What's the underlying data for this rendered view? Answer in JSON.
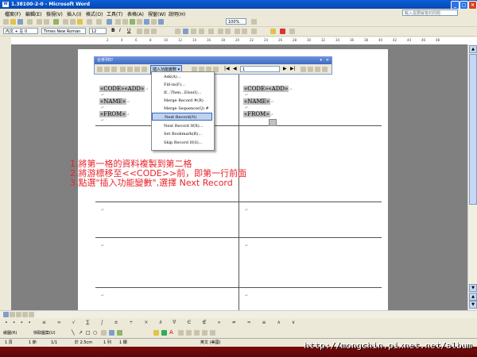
{
  "window": {
    "title": "1.38100-2-0 - Microsoft Word"
  },
  "menubar": {
    "items": [
      "檔案(F)",
      "編輯(E)",
      "檢視(V)",
      "插入(I)",
      "格式(O)",
      "工具(T)",
      "表格(A)",
      "視窗(W)",
      "說明(H)"
    ],
    "help_placeholder": "輸入需要解答的問題"
  },
  "toolbar": {
    "zoom": "100%",
    "style": "內文 + 左 0",
    "font": "Times New Roman",
    "size": "12"
  },
  "mailmerge_toolbar": {
    "title": "合併列印",
    "insert_word_field_label": "插入功能變數",
    "record_number": "1"
  },
  "dropdown": {
    "items": [
      "Ask(A)...",
      "Fill-in(F)...",
      "If...Then...Else(I)...",
      "Merge Record #(R)",
      "Merge Sequence(Q) #",
      "Next Record(N)",
      "Next Record If(X)...",
      "Set Bookmark(B)...",
      "Skip Record If(S)..."
    ],
    "selected_index": 5
  },
  "document": {
    "left_cell": {
      "line1": "«CODE»«ADD»",
      "line2": "«NAME»",
      "line3": "«FROM»"
    },
    "right_cell": {
      "line1": "«CODE»«ADD»",
      "line2": "«NAME»",
      "line3": "«FROM»"
    },
    "paragraph_mark": "↵"
  },
  "annotations": [
    "1.將第一格的資料複製到第二格",
    "2.將游標移至<<CODE>>前，即第一行前面",
    "3.點選\"插入功能變數\",選擇 Next Record"
  ],
  "statusbar": {
    "page": "1 頁",
    "section": "1 節",
    "page_of": "1/1",
    "position": "於 2.5cm",
    "line": "1 列",
    "column": "1 欄",
    "language": "英文 (美國)"
  },
  "drawbar": {
    "draw_label": "繪圖(R)",
    "autoshapes_label": "快取圖案(U)"
  },
  "watermark": "http://mongchin.pixnet.net/album"
}
